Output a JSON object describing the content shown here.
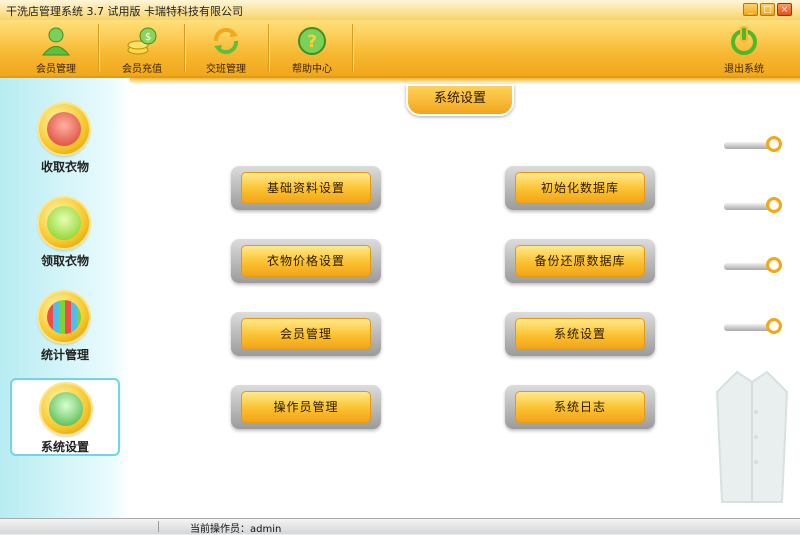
{
  "window": {
    "title": "干洗店管理系统  3.7 试用版 卡瑞特科技有限公司",
    "min": "_",
    "max": "□",
    "close": "×"
  },
  "toolbar": {
    "items": [
      {
        "label": "会员管理",
        "icon": "member-icon"
      },
      {
        "label": "会员充值",
        "icon": "money-icon"
      },
      {
        "label": "交班管理",
        "icon": "refresh-icon"
      },
      {
        "label": "帮助中心",
        "icon": "help-icon"
      },
      {
        "label": "退出系统",
        "icon": "power-icon"
      }
    ]
  },
  "sidebar": {
    "items": [
      {
        "label": "收取衣物",
        "icon": "shirt-icon"
      },
      {
        "label": "领取衣物",
        "icon": "bag-icon"
      },
      {
        "label": "统计管理",
        "icon": "stats-icon"
      },
      {
        "label": "系统设置",
        "icon": "system-monitor-icon",
        "active": true
      }
    ]
  },
  "panel": {
    "title": "系统设置"
  },
  "buttons": {
    "basic": "基础资料设置",
    "init_db": "初始化数据库",
    "price": "衣物价格设置",
    "backup": "备份还原数据库",
    "member": "会员管理",
    "system": "系统设置",
    "operator": "操作员管理",
    "log": "系统日志"
  },
  "status": {
    "operator": "当前操作员：admin"
  },
  "colors": {
    "accent": "#f7b832",
    "sidebar": "#b7ecf2"
  }
}
